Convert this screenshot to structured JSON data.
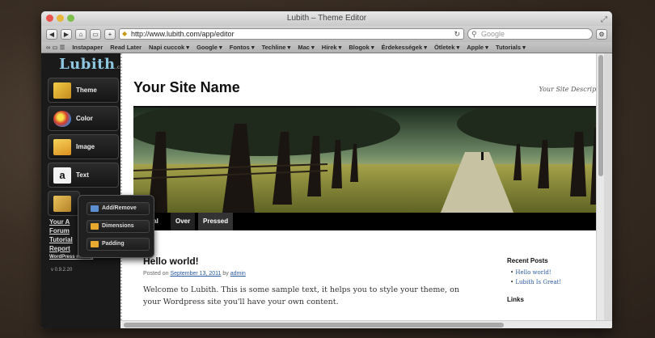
{
  "window": {
    "title": "Lubith – Theme Editor"
  },
  "toolbar": {
    "back": "◀",
    "forward": "▶",
    "home": "⌂",
    "bookmark": "▭",
    "add": "+",
    "url": "http://www.lubith.com/app/editor",
    "search_placeholder": "Google"
  },
  "bookmarks": [
    "Instapaper",
    "Read Later",
    "Napi cuccok ▾",
    "Google ▾",
    "Fontos ▾",
    "Techline ▾",
    "Mac ▾",
    "Hírek ▾",
    "Blogok ▾",
    "Érdekességek ▾",
    "Ötletek ▾",
    "Apple ▾",
    "Tutorials ▾"
  ],
  "sidebar": {
    "logo": "Lubith",
    "logo_suffix": ".com",
    "buttons": [
      {
        "label": "Theme",
        "color": "#e0b030"
      },
      {
        "label": "Color",
        "color": "#d84a2a"
      },
      {
        "label": "Image",
        "color": "#e6a32c"
      },
      {
        "label": "Text",
        "color": "#f0f0f0"
      }
    ],
    "links": [
      "Your A",
      "Forum",
      "Tutorial",
      "Report",
      "WordPress making"
    ],
    "version": "v 0.9.2.20"
  },
  "popup": {
    "items": [
      {
        "label": "Add/Remove",
        "color": "#5b8fd0"
      },
      {
        "label": "Dimensions",
        "color": "#e7a92e"
      },
      {
        "label": "Padding",
        "color": "#e7a92e"
      }
    ]
  },
  "page": {
    "site_name": "Your Site Name",
    "site_description": "Your Site Descripti",
    "menu": [
      "rmal",
      "Over",
      "Pressed"
    ],
    "post": {
      "title": "Hello world!",
      "meta_prefix": "Posted on",
      "date": "September 13, 2011",
      "meta_by": "by",
      "author": "admin",
      "body": "Welcome to Lubith. This is some sample text, it helps you to style your theme, on your Wordpress site you'll have your own content."
    },
    "recent_posts_heading": "Recent Posts",
    "recent_posts": [
      "Hello world!",
      "Lubith Is Great!"
    ],
    "links_heading": "Links"
  }
}
